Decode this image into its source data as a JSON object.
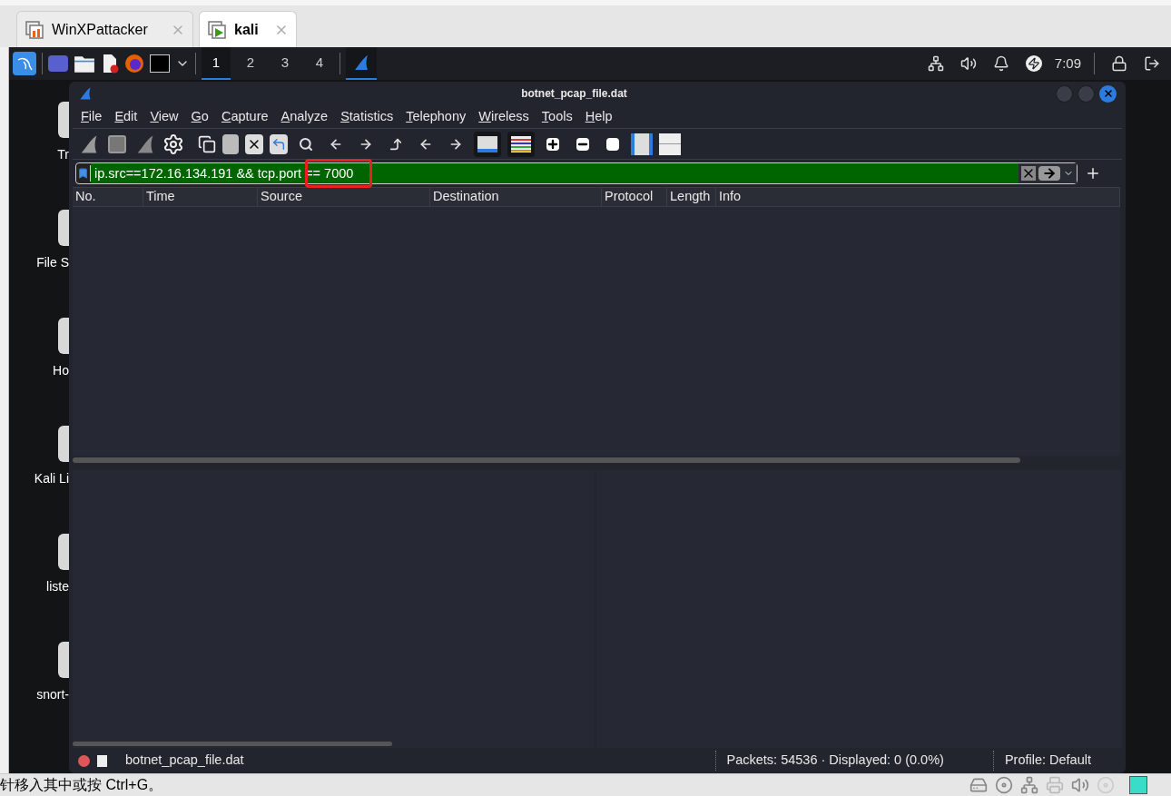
{
  "host_tabs": [
    {
      "label": "WinXPattacker",
      "selected": false
    },
    {
      "label": "kali",
      "selected": true
    }
  ],
  "panel": {
    "workspaces": [
      {
        "label": "1",
        "selected": true
      },
      {
        "label": "2",
        "selected": false
      },
      {
        "label": "3",
        "selected": false
      },
      {
        "label": "4",
        "selected": false
      }
    ],
    "clock": "7:09"
  },
  "desktop_icons": [
    {
      "label": "Tr"
    },
    {
      "label": "File S"
    },
    {
      "label": "Ho"
    },
    {
      "label": "Kali Li"
    },
    {
      "label": "liste"
    },
    {
      "label": "snort-"
    }
  ],
  "window": {
    "title": "botnet_pcap_file.dat"
  },
  "menu": [
    "File",
    "Edit",
    "View",
    "Go",
    "Capture",
    "Analyze",
    "Statistics",
    "Telephony",
    "Wireless",
    "Tools",
    "Help"
  ],
  "filter": {
    "value": "ip.src==172.16.134.191 && tcp.port == 7000",
    "valid": true
  },
  "table": {
    "columns": [
      "No.",
      "Time",
      "Source",
      "Destination",
      "Protocol",
      "Length",
      "Info"
    ]
  },
  "status_bar": {
    "file": "botnet_pcap_file.dat",
    "packets": "Packets: 54536 · Displayed: 0 (0.0%)",
    "profile": "Profile: Default"
  },
  "host_status": "针移入其中或按 Ctrl+G。"
}
